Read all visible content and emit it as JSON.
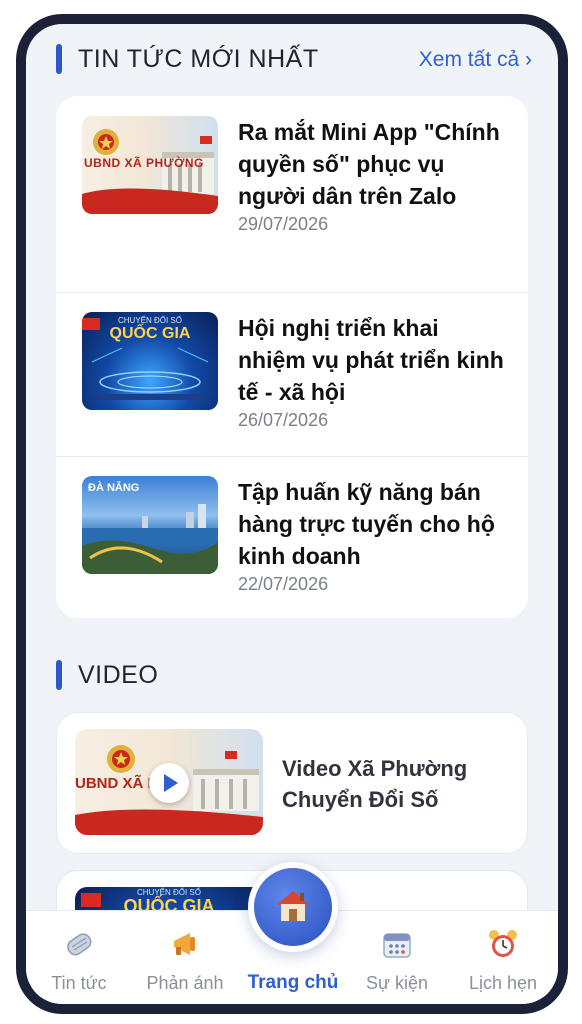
{
  "news_section": {
    "title": "TIN TỨC MỚI NHẤT",
    "see_all": "Xem tất cả ›",
    "items": [
      {
        "title": "Ra mắt Mini App \"Chính quyền số\" phục vụ người dân trên Zalo",
        "date": "29/07/2026",
        "thumb_caption": "UBND XÃ PHƯỜNG"
      },
      {
        "title": "Hội nghị triển khai nhiệm vụ phát triển kinh tế - xã hội",
        "date": "26/07/2026",
        "thumb_caption": "QUỐC GIA",
        "thumb_subcaption": "CHUYỂN ĐỔI SỐ"
      },
      {
        "title": "Tập huấn kỹ năng bán hàng trực tuyến cho hộ kinh doanh",
        "date": "22/07/2026",
        "thumb_caption": "ĐÀ NẴNG"
      }
    ]
  },
  "video_section": {
    "title": "VIDEO",
    "items": [
      {
        "title": "Video Xã Phường Chuyển Đổi Số",
        "thumb_caption": "UBND XÃ PHƯ"
      },
      {
        "title": "",
        "thumb_caption": "QUỐC GIA",
        "thumb_subcaption": "CHUYỂN ĐỔI SỐ"
      }
    ]
  },
  "bottom_nav": {
    "items": [
      {
        "label": "Tin tức",
        "icon": "newspaper-icon"
      },
      {
        "label": "Phản ánh",
        "icon": "megaphone-icon"
      },
      {
        "label": "Trang chủ",
        "icon": "home-icon",
        "active": true
      },
      {
        "label": "Sự kiện",
        "icon": "calendar-icon"
      },
      {
        "label": "Lịch hẹn",
        "icon": "alarm-clock-icon"
      }
    ]
  },
  "colors": {
    "accent": "#2f5fd0",
    "frame": "#1b2238",
    "background": "#f0f3f8"
  }
}
